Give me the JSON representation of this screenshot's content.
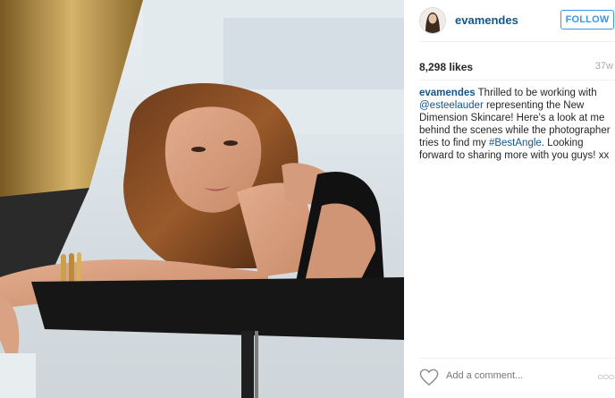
{
  "post": {
    "username": "evamendes",
    "follow_label": "FOLLOW",
    "likes": "8,298 likes",
    "time_ago": "37w",
    "caption": {
      "user": "evamendes",
      "part1": " Thrilled to be working with ",
      "mention": "@esteelauder",
      "part2": " representing the New Dimension Skincare! Here's a look at me behind the scenes while the photographer tries to find my ",
      "hashtag": "#BestAngle",
      "part3": ". Looking forward to sharing more with you guys! xx"
    },
    "comment_placeholder": "Add a comment...",
    "more_label": "○○○"
  },
  "icons": {
    "like": "heart-icon",
    "more": "more-options-icon"
  },
  "colors": {
    "username": "#125688",
    "follow": "#3897f0",
    "muted": "#a5a7aa",
    "text": "#262626"
  }
}
